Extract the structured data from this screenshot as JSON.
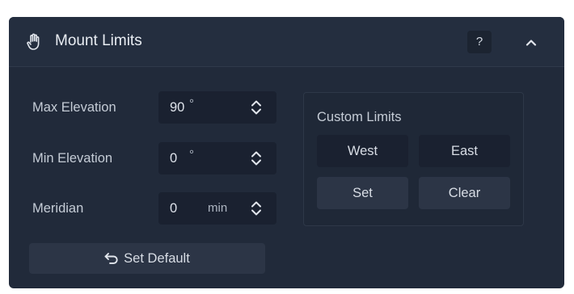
{
  "header": {
    "title": "Mount Limits",
    "help_label": "?",
    "icon": "hand-icon",
    "collapse_icon": "chevron-up-icon"
  },
  "fields": [
    {
      "label": "Max Elevation",
      "value": "90",
      "unit": "°"
    },
    {
      "label": "Min Elevation",
      "value": "0",
      "unit": "°"
    },
    {
      "label": "Meridian",
      "value": "0",
      "unit": "min"
    }
  ],
  "custom_limits": {
    "title": "Custom Limits",
    "west_label": "West",
    "east_label": "East",
    "set_label": "Set",
    "clear_label": "Clear"
  },
  "footer": {
    "set_default_label": "Set Default",
    "icon": "undo-icon"
  }
}
